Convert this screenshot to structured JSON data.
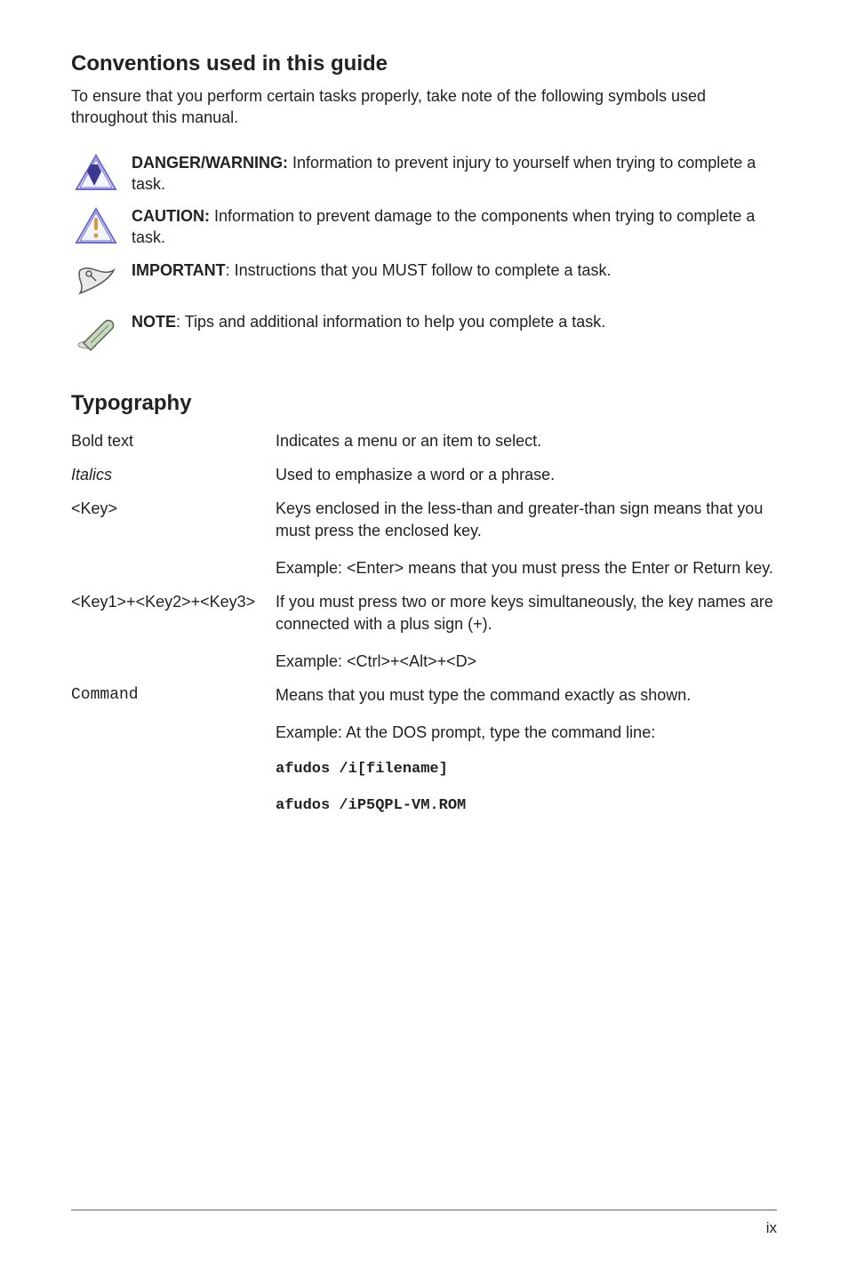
{
  "conventions": {
    "heading": "Conventions used in this guide",
    "intro": "To ensure that you perform certain tasks properly, take note of the following symbols used throughout this manual.",
    "items": [
      {
        "icon": "danger-icon",
        "label": "DANGER/WARNING:",
        "text": " Information to prevent injury to yourself when trying to complete a task."
      },
      {
        "icon": "caution-icon",
        "label": "CAUTION:",
        "text": " Information to prevent damage to the components when trying to complete a task."
      },
      {
        "icon": "important-icon",
        "label": "IMPORTANT",
        "text": ": Instructions that you MUST follow to complete a task."
      },
      {
        "icon": "note-icon",
        "label": "NOTE",
        "text": ": Tips and additional information to help you complete a task."
      }
    ]
  },
  "typography": {
    "heading": "Typography",
    "rows": [
      {
        "term": "Bold text",
        "term_style": "plain",
        "defs": [
          "Indicates a menu or an item to select."
        ]
      },
      {
        "term": "Italics",
        "term_style": "italic",
        "defs": [
          "Used to emphasize a word or a phrase."
        ]
      },
      {
        "term": "<Key>",
        "term_style": "plain",
        "defs": [
          "Keys enclosed in the less-than and greater-than sign means that you must press the enclosed key.",
          "Example: <Enter> means that you must press the Enter or Return key."
        ]
      },
      {
        "term": "<Key1>+<Key2>+<Key3>",
        "term_style": "plain",
        "defs": [
          "If you must press two or more keys simultaneously, the key names are connected with a plus sign (+).",
          "Example: <Ctrl>+<Alt>+<D>"
        ]
      },
      {
        "term": "Command",
        "term_style": "mono",
        "defs": [
          "Means that you must type the command exactly as shown.",
          "Example: At the DOS prompt, type the command line:"
        ],
        "mono_lines": [
          "afudos /i[filename]",
          "afudos /iP5QPL-VM.ROM"
        ]
      }
    ]
  },
  "page_number": "ix"
}
